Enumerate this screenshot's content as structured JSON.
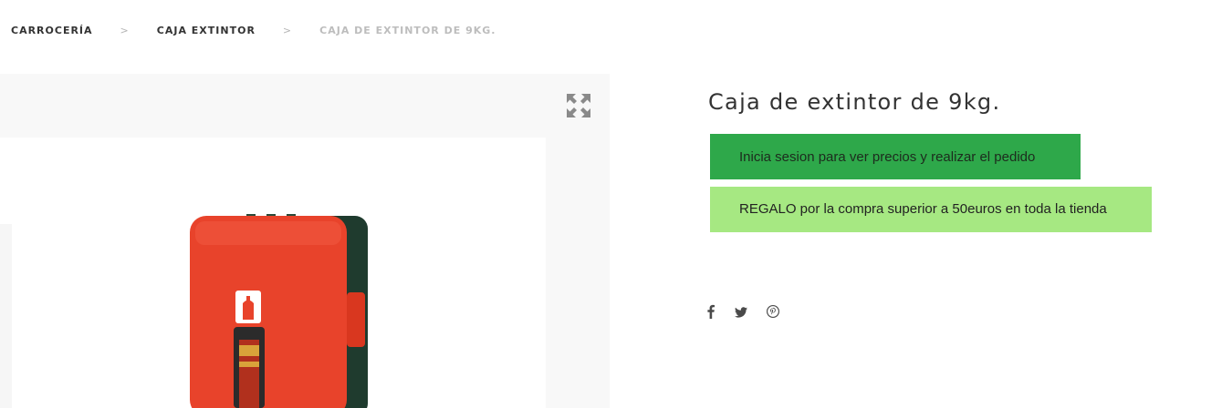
{
  "breadcrumb": {
    "items": [
      "CARROCERÍA",
      "CAJA EXTINTOR"
    ],
    "separator": ">",
    "current": "CAJA DE EXTINTOR DE 9KG."
  },
  "product": {
    "title": "Caja de extintor de 9kg.",
    "login_button": "Inicia sesion para ver precios y realizar el pedido",
    "promo_text": "REGALO por la compra superior a 50euros en toda la tienda"
  },
  "gallery": {
    "expand_icon": "expand-icon",
    "image_alt": "extintor-box-image"
  },
  "share": {
    "icons": [
      "facebook-icon",
      "twitter-icon",
      "pinterest-icon"
    ]
  },
  "colors": {
    "login_bg": "#2ea84a",
    "promo_bg": "#a6e882",
    "box_red": "#e8432b",
    "box_dark": "#1f3b2e"
  }
}
